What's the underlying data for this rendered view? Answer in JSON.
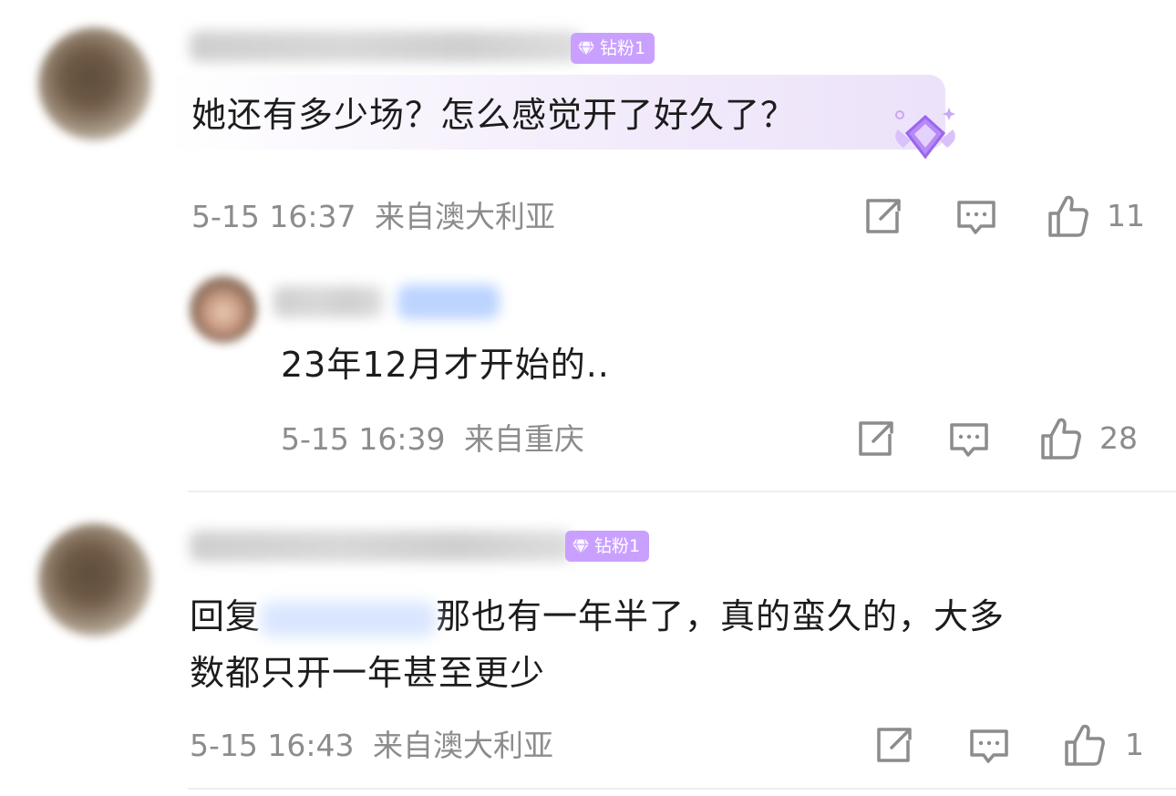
{
  "comments": [
    {
      "badge": "钻粉1",
      "text": "她还有多少场？怎么感觉开了好久了？",
      "time": "5-15 16:37",
      "location": "来自澳大利亚",
      "likes": "11"
    },
    {
      "text": "23年12月才开始的..",
      "time": "5-15 16:39",
      "location": "来自重庆",
      "likes": "28"
    },
    {
      "badge": "钻粉1",
      "reply_prefix": "回复",
      "text_line1": "那也有一年半了，真的蛮久的，大多",
      "text_line2": "数都只开一年甚至更少",
      "time": "5-15 16:43",
      "location": "来自澳大利亚",
      "likes": "1"
    }
  ],
  "icons": [
    "forward-icon",
    "comment-icon",
    "like-icon",
    "diamond-gem-icon",
    "diamond-medal-icon"
  ],
  "colors": {
    "badge": "#c9a0ff",
    "meta_text": "#8c8c8c",
    "accent_purple": "#a070f0"
  }
}
